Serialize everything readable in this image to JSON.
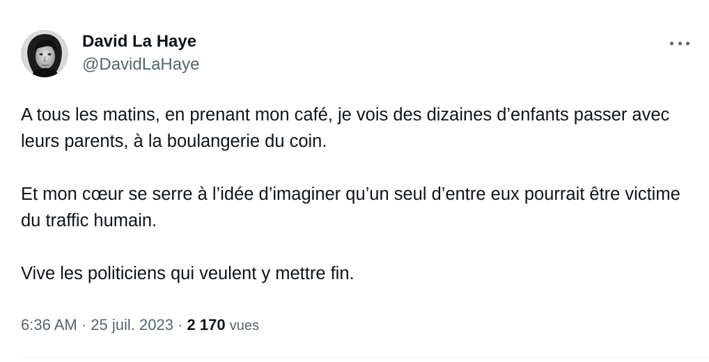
{
  "author": {
    "display_name": "David La Haye",
    "handle": "@DavidLaHaye"
  },
  "icons": {
    "avatar": "avatar-photo",
    "more": "more-options-icon"
  },
  "tweet": {
    "paragraphs": [
      "A tous les matins, en prenant mon café, je vois des dizaines d’enfants passer avec leurs parents, à la boulangerie du coin.",
      "Et mon cœur se serre à l’idée d’imaginer qu’un seul d’entre eux pourrait être victime du traffic humain.",
      "Vive les politiciens qui veulent y mettre fin."
    ]
  },
  "meta": {
    "time": "6:36 AM",
    "separator": "·",
    "date": "25 juil. 2023",
    "views_count": "2 170",
    "views_label": "vues"
  },
  "colors": {
    "text_primary": "#0f1419",
    "text_secondary": "#536471",
    "divider": "#eff3f4"
  }
}
